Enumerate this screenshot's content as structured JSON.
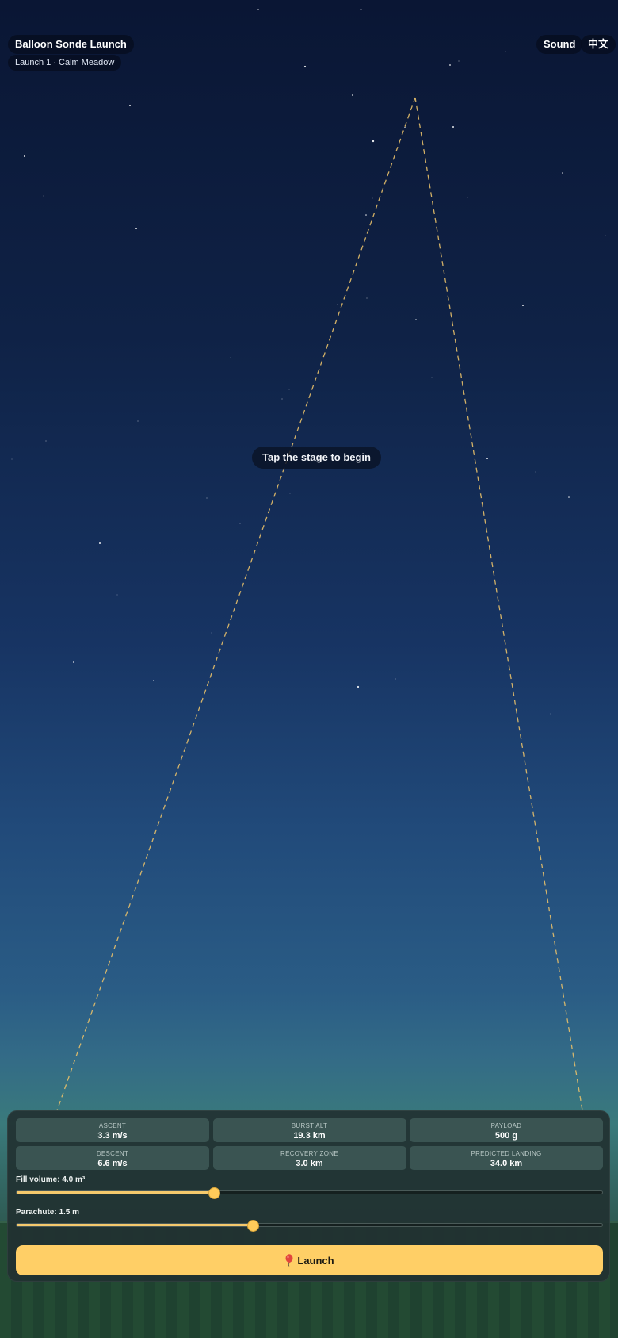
{
  "header": {
    "title": "Balloon Sonde Launch",
    "subtitle": "Launch 1 · Calm Meadow",
    "sound_label": "Sound",
    "language_label": "中文"
  },
  "stage": {
    "hint": "Tap the stage to begin"
  },
  "stats": [
    {
      "label": "ASCENT",
      "value": "3.3 m/s"
    },
    {
      "label": "BURST ALT",
      "value": "19.3 km"
    },
    {
      "label": "PAYLOAD",
      "value": "500 g"
    },
    {
      "label": "DESCENT",
      "value": "6.6 m/s"
    },
    {
      "label": "RECOVERY ZONE",
      "value": "3.0 km"
    },
    {
      "label": "PREDICTED LANDING",
      "value": "34.0 km"
    }
  ],
  "controls": {
    "fill_volume": {
      "label": "Fill volume: 4.0 m³",
      "fraction": 0.335
    },
    "parachute": {
      "label": "Parachute: 1.5 m",
      "fraction": 0.402
    }
  },
  "launch": {
    "label": "Launch",
    "icon": "balloon-icon"
  },
  "colors": {
    "accent": "#ffcf66",
    "trajectory": "#e8c06a",
    "sky_top": "#0a1634",
    "ground": "#234a33"
  }
}
